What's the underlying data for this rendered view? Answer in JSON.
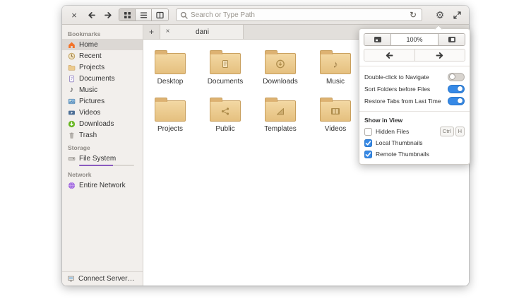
{
  "toolbar": {
    "search_placeholder": "Search or Type Path",
    "grid_view_active": true
  },
  "icons": {
    "close": "×",
    "gear": "⚙",
    "refresh": "↻",
    "new_tab": "+",
    "tab_close": "×",
    "music_note": "♪"
  },
  "tab": {
    "label": "dani"
  },
  "sidebar": {
    "sections": [
      {
        "header": "Bookmarks",
        "items": [
          {
            "label": "Home",
            "icon": "home-icon",
            "selected": true
          },
          {
            "label": "Recent",
            "icon": "recent-icon",
            "selected": false
          },
          {
            "label": "Projects",
            "icon": "folder-icon",
            "selected": false
          },
          {
            "label": "Documents",
            "icon": "documents-icon",
            "selected": false
          },
          {
            "label": "Music",
            "icon": "music-icon",
            "selected": false
          },
          {
            "label": "Pictures",
            "icon": "pictures-icon",
            "selected": false
          },
          {
            "label": "Videos",
            "icon": "videos-icon",
            "selected": false
          },
          {
            "label": "Downloads",
            "icon": "downloads-icon",
            "selected": false
          },
          {
            "label": "Trash",
            "icon": "trash-icon",
            "selected": false
          }
        ]
      },
      {
        "header": "Storage",
        "items": [
          {
            "label": "File System",
            "icon": "filesystem-icon",
            "selected": false
          }
        ]
      },
      {
        "header": "Network",
        "items": [
          {
            "label": "Entire Network",
            "icon": "network-icon",
            "selected": false
          }
        ]
      }
    ],
    "connect_server": "Connect Server…"
  },
  "files": [
    {
      "name": "Desktop",
      "emblem": "none"
    },
    {
      "name": "Documents",
      "emblem": "document"
    },
    {
      "name": "Downloads",
      "emblem": "download"
    },
    {
      "name": "Music",
      "emblem": "music"
    },
    {
      "name": "Projects",
      "emblem": "none"
    },
    {
      "name": "Public",
      "emblem": "share"
    },
    {
      "name": "Templates",
      "emblem": "template"
    },
    {
      "name": "Videos",
      "emblem": "video"
    }
  ],
  "popover": {
    "zoom_level": "100%",
    "toggles": [
      {
        "label": "Double-click to Navigate",
        "state": false
      },
      {
        "label": "Sort Folders before Files",
        "state": true
      },
      {
        "label": "Restore Tabs from Last Time",
        "state": true
      }
    ],
    "show_in_view": "Show in View",
    "checkboxes": [
      {
        "label": "Hidden Files",
        "checked": false,
        "shortcut": [
          "Ctrl",
          "H"
        ]
      },
      {
        "label": "Local Thumbnails",
        "checked": true
      },
      {
        "label": "Remote Thumbnails",
        "checked": true
      }
    ],
    "accent": "#3689e6"
  }
}
